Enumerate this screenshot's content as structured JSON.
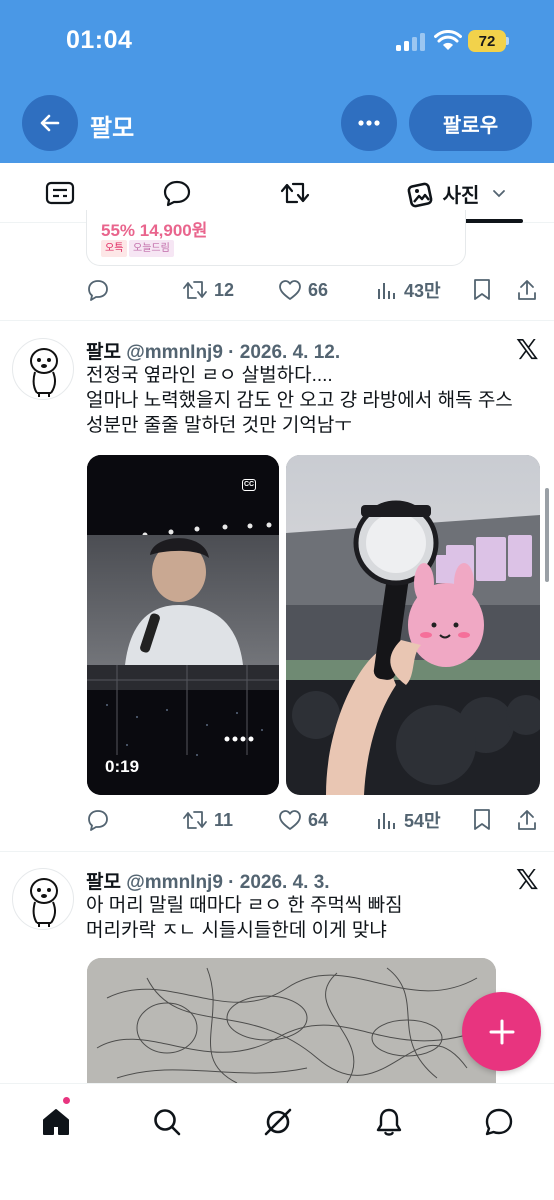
{
  "status_bar": {
    "time": "01:04",
    "battery": "72"
  },
  "header": {
    "title": "팔모",
    "follow_label": "팔로우"
  },
  "tabs": {
    "active_label": "사진"
  },
  "prev_tweet": {
    "price": "55% 14,900원",
    "tags": [
      "오특",
      "오늘드림"
    ],
    "retweets": "12",
    "likes": "66",
    "views": "43만"
  },
  "tweets": [
    {
      "name": "팔모",
      "meta": "@mmnInj9 · 2026. 4. 12.",
      "lines": [
        "전정국 옆라인 ㄹㅇ 살벌하다....",
        "얼마나 노력했을지 감도 안 오고 걍 라방에서 해독 주스",
        "성분만 줄줄 말하던 것만 기억남ㅜ"
      ],
      "video_duration": "0:19",
      "retweets": "11",
      "likes": "64",
      "views": "54만"
    },
    {
      "name": "팔모",
      "meta": "@mmnInj9 · 2026. 4. 3.",
      "lines": [
        "아 머리 말릴 때마다 ㄹㅇ 한 주먹씩 빠짐",
        "머리카락 ㅈㄴ 시들시들한데 이게 맞냐"
      ]
    }
  ],
  "colors": {
    "header_bg": "#4a98e6",
    "button_bg": "#2f6fc0",
    "fab": "#e8347f"
  },
  "icons": [
    "back-arrow-icon",
    "more-dots-icon",
    "timeline-icon",
    "reply-tab-icon",
    "retweet-tab-icon",
    "photo-tab-icon",
    "chevron-down-icon",
    "reply-icon",
    "retweet-icon",
    "like-icon",
    "views-icon",
    "bookmark-icon",
    "share-icon",
    "x-logo-icon",
    "compose-icon",
    "home-icon",
    "search-icon",
    "grok-icon",
    "bell-icon",
    "messages-icon"
  ]
}
